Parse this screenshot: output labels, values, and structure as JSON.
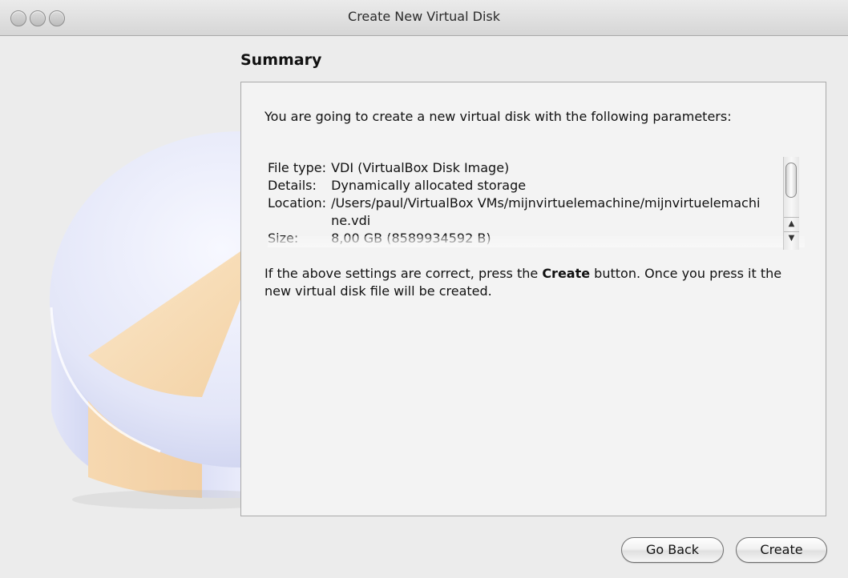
{
  "window": {
    "title": "Create New Virtual Disk"
  },
  "page": {
    "heading": "Summary",
    "intro": "You are going to create a new virtual disk with the following parameters:",
    "params": [
      {
        "key": "File type:",
        "value": "VDI (VirtualBox Disk Image)"
      },
      {
        "key": "Details:",
        "value": "Dynamically allocated storage"
      },
      {
        "key": "Location:",
        "value": "/Users/paul/VirtualBox VMs/mijnvirtuelemachine/mijnvirtuelemachine.vdi"
      },
      {
        "key": "Size:",
        "value": "8,00 GB (8589934592 B)"
      }
    ],
    "outro_before": "If the above settings are correct, press the ",
    "outro_bold": "Create",
    "outro_after": " button. Once you press it the new virtual disk file will be created."
  },
  "buttons": {
    "back": "Go Back",
    "create": "Create"
  },
  "scrollbar": {
    "up_arrow": "▲",
    "down_arrow": "▼"
  },
  "illustration": {
    "colors": {
      "disk_top": "#eef0fb",
      "disk_side": "#d4d8f3",
      "used_slice": "#f8d9ad"
    }
  }
}
